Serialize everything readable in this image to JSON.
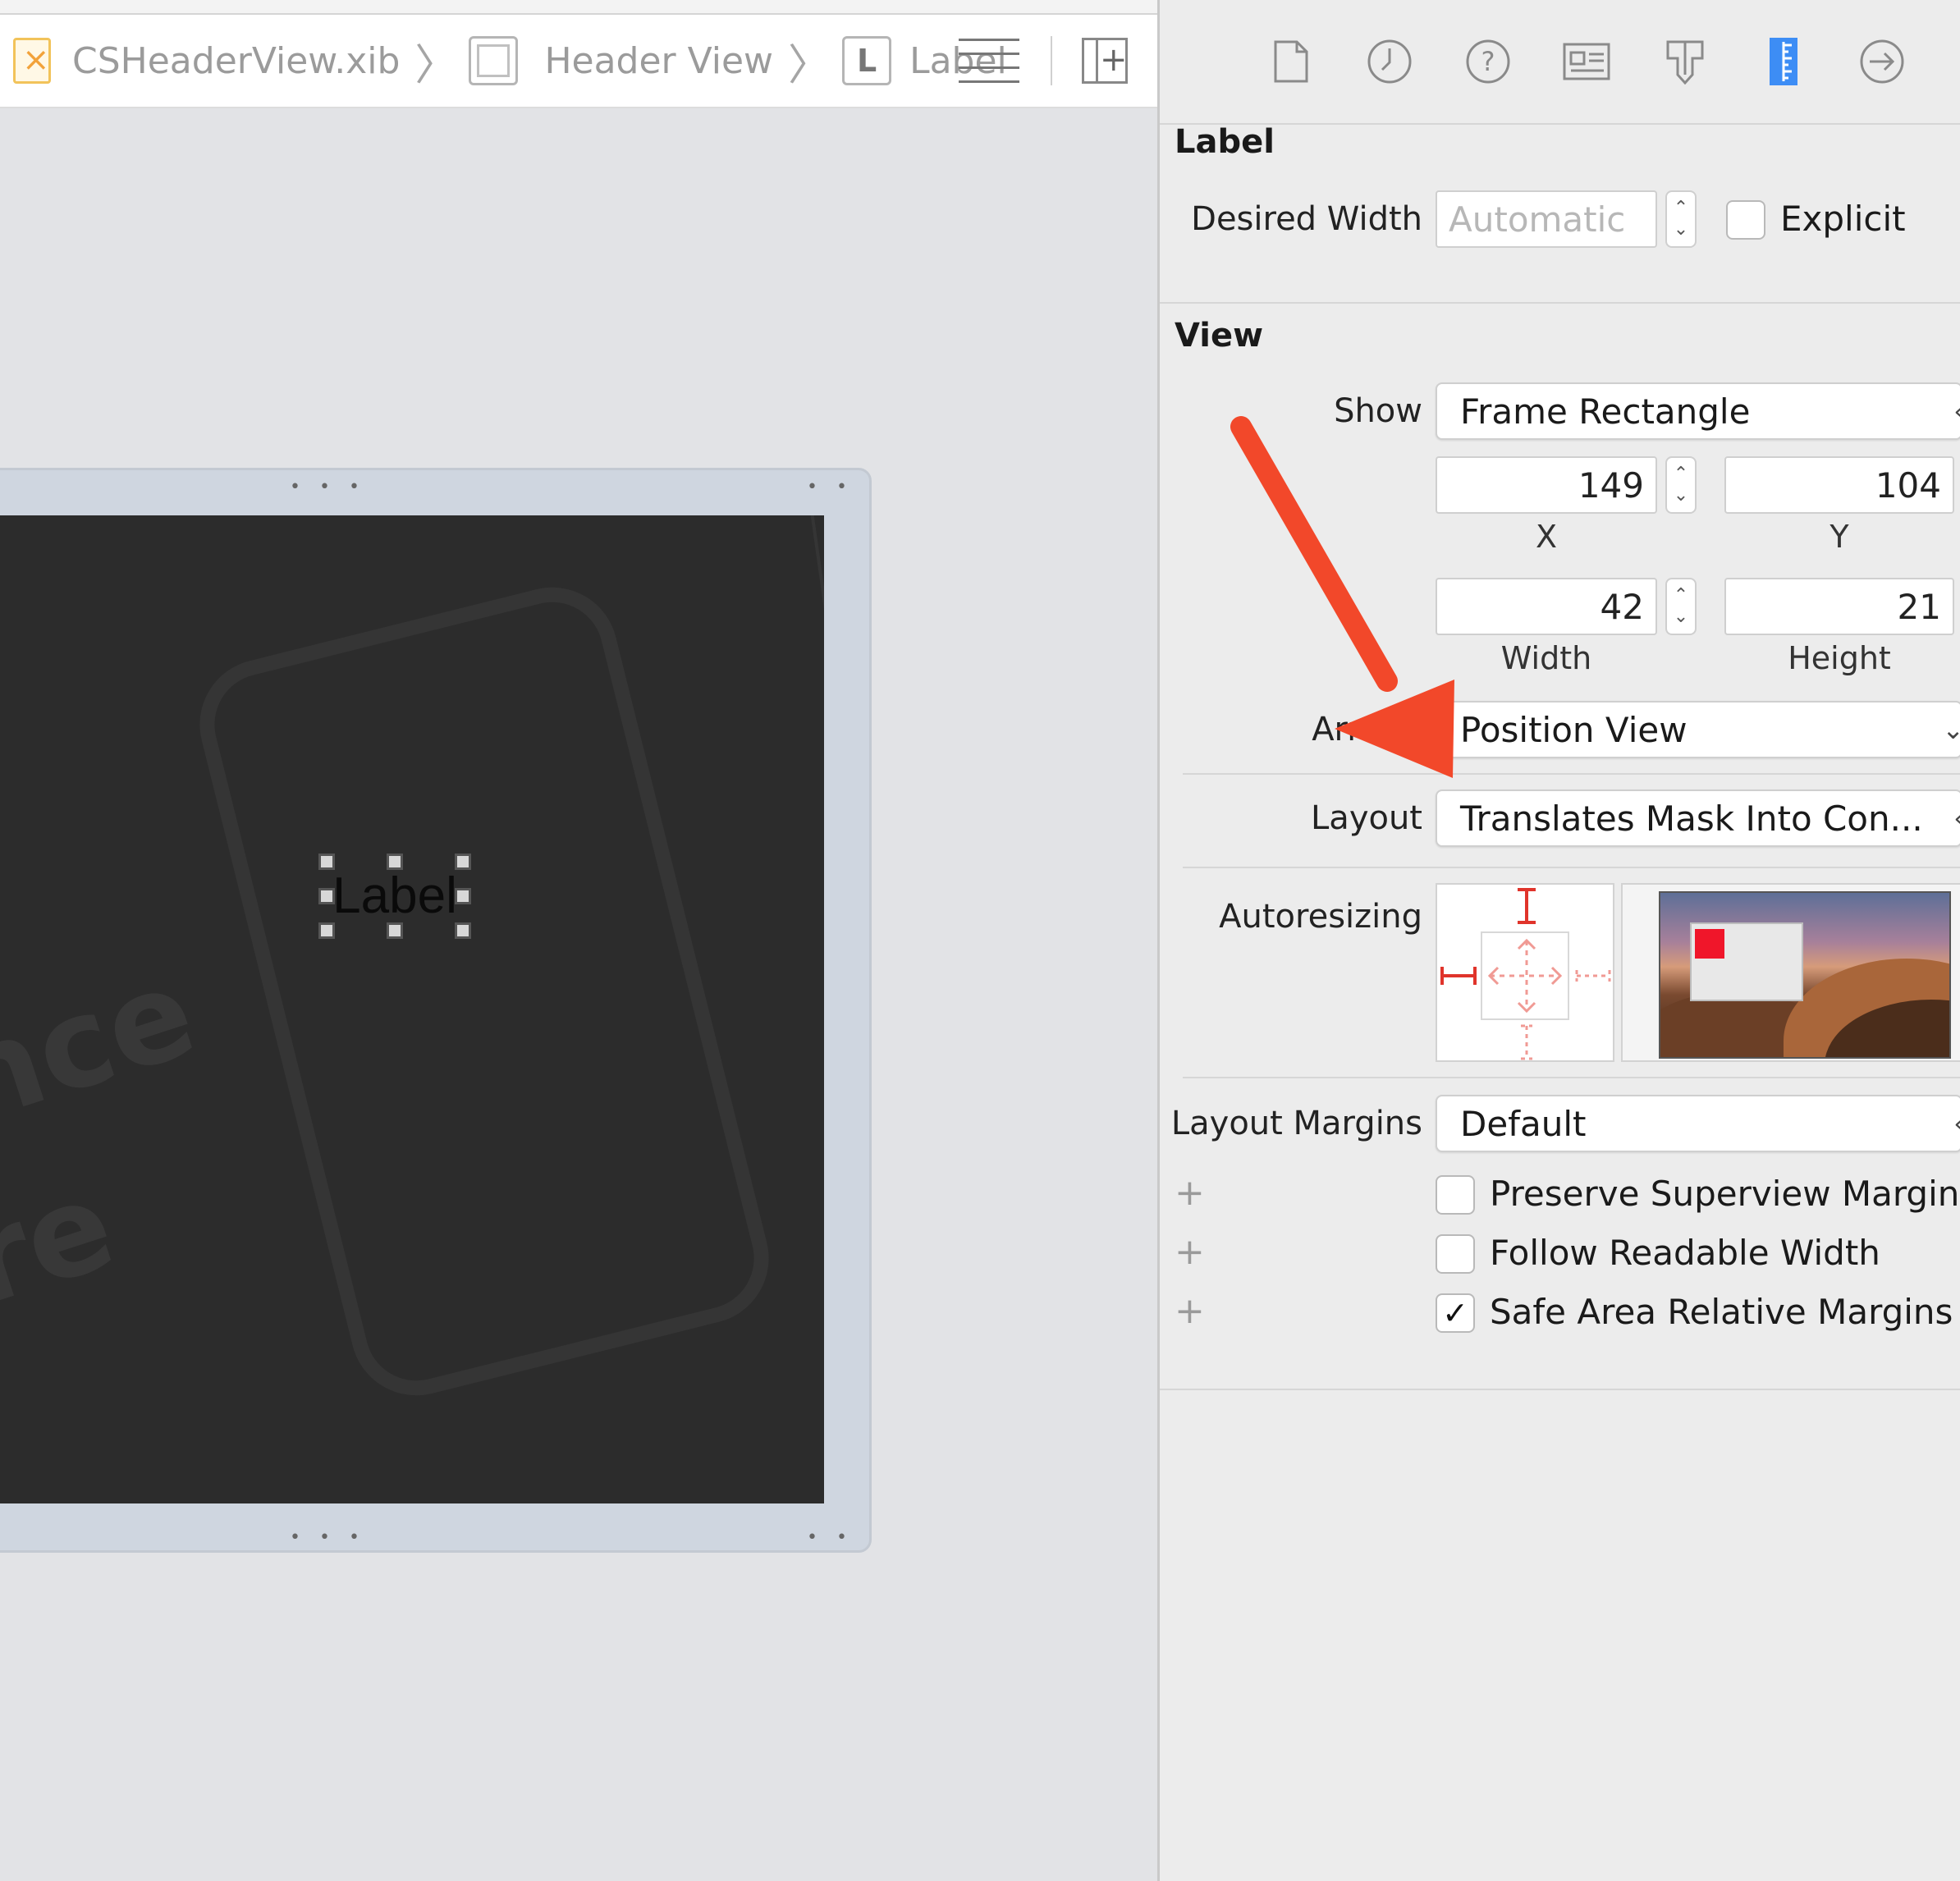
{
  "jumpbar": {
    "file": "CSHeaderView.xib",
    "view": "Header View",
    "label_icon_letter": "L",
    "label": "Label"
  },
  "canvas": {
    "selected_label_text": "Label",
    "resize_dots": "• • •"
  },
  "inspector": {
    "tabs": [
      "file-icon",
      "history-icon",
      "help-icon",
      "identity-icon",
      "attributes-icon",
      "size-icon",
      "connections-icon"
    ],
    "active_tab": "size-icon",
    "label_section": {
      "title": "Label",
      "desired_width_label": "Desired Width",
      "desired_width_placeholder": "Automatic",
      "explicit_label": "Explicit",
      "explicit_checked": false
    },
    "view_section": {
      "title": "View",
      "show_label": "Show",
      "show_value": "Frame Rectangle",
      "x_value": "149",
      "x_label": "X",
      "y_value": "104",
      "y_label": "Y",
      "width_value": "42",
      "width_label": "Width",
      "height_value": "21",
      "height_label": "Height",
      "arrange_label": "Arrang",
      "arrange_value": "Position View",
      "layout_label": "Layout",
      "layout_value": "Translates Mask Into Con...",
      "autoresizing_label": "Autoresizing",
      "layout_margins_label": "Layout Margins",
      "layout_margins_value": "Default",
      "plus_symbol": "+",
      "options": [
        {
          "label": "Preserve Superview Margins",
          "checked": false
        },
        {
          "label": "Follow Readable Width",
          "checked": false
        },
        {
          "label": "Safe Area Relative Margins",
          "checked": true
        }
      ]
    }
  },
  "colors": {
    "accent": "#3d8df5",
    "arrow": "#f2482a",
    "autoresize_strut": "#e0342b",
    "selection_red": "#f0162a"
  }
}
